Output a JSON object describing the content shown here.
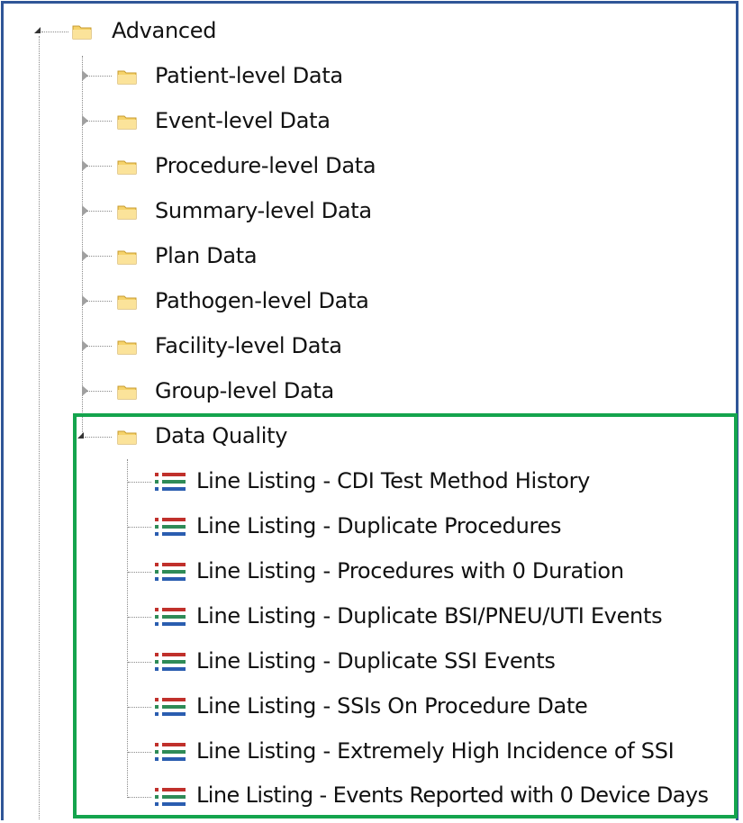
{
  "root": {
    "label": "Advanced",
    "icon": "folder-icon",
    "expanded": true
  },
  "folders": [
    {
      "label": "Patient-level Data",
      "icon": "folder-icon",
      "expanded": false
    },
    {
      "label": "Event-level Data",
      "icon": "folder-icon",
      "expanded": false
    },
    {
      "label": "Procedure-level Data",
      "icon": "folder-icon",
      "expanded": false
    },
    {
      "label": "Summary-level Data",
      "icon": "folder-icon",
      "expanded": false
    },
    {
      "label": "Plan Data",
      "icon": "folder-icon",
      "expanded": false
    },
    {
      "label": "Pathogen-level Data",
      "icon": "folder-icon",
      "expanded": false
    },
    {
      "label": "Facility-level Data",
      "icon": "folder-icon",
      "expanded": false
    },
    {
      "label": "Group-level Data",
      "icon": "folder-icon",
      "expanded": false
    }
  ],
  "data_quality": {
    "label": "Data Quality",
    "icon": "folder-icon",
    "expanded": true,
    "reports": [
      {
        "label": "Line Listing - CDI Test Method History",
        "icon": "line-listing-icon"
      },
      {
        "label": "Line Listing - Duplicate Procedures",
        "icon": "line-listing-icon"
      },
      {
        "label": "Line Listing - Procedures with 0 Duration",
        "icon": "line-listing-icon"
      },
      {
        "label": "Line Listing - Duplicate BSI/PNEU/UTI Events",
        "icon": "line-listing-icon"
      },
      {
        "label": "Line Listing - Duplicate SSI Events",
        "icon": "line-listing-icon"
      },
      {
        "label": "Line Listing - SSIs On Procedure Date",
        "icon": "line-listing-icon"
      },
      {
        "label": "Line Listing - Extremely High Incidence of SSI",
        "icon": "line-listing-icon"
      },
      {
        "label": "Line Listing - Events Reported with 0 Device Days",
        "icon": "line-listing-icon"
      }
    ]
  },
  "colors": {
    "frame_border": "#2f5597",
    "highlight_border": "#14a44d",
    "folder_fill": "#f6d36b",
    "list_red": "#c0302b",
    "list_green": "#2e8b57",
    "list_blue": "#2a5db0"
  }
}
